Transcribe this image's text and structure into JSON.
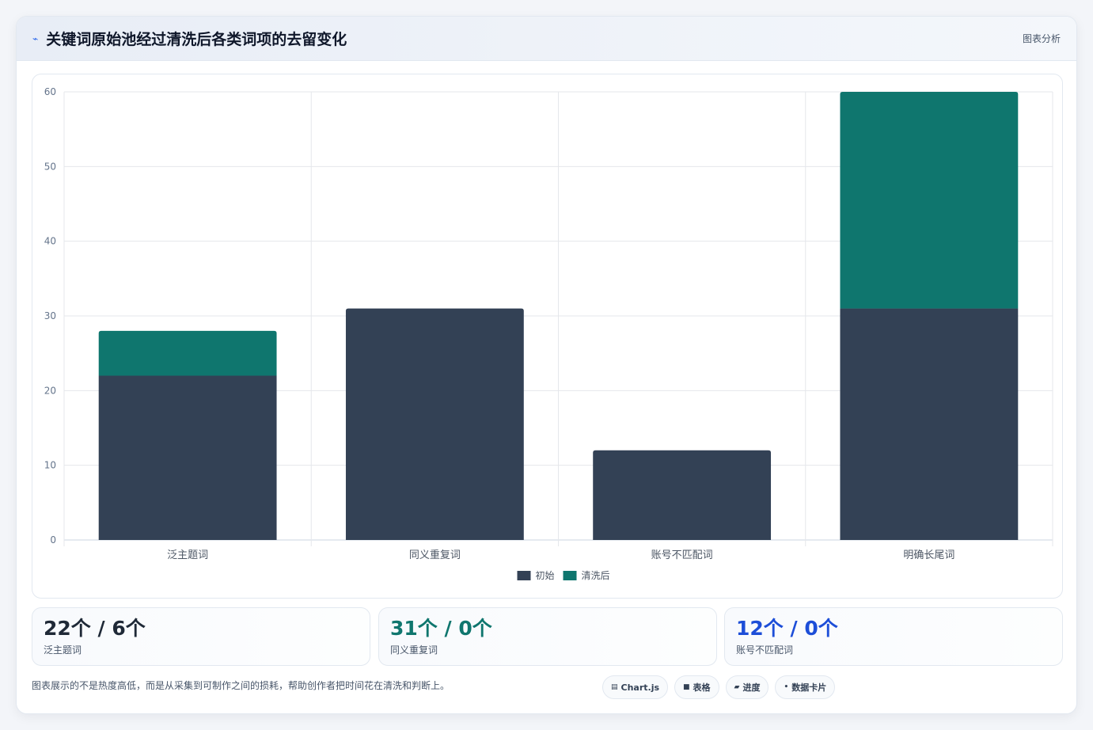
{
  "header": {
    "title_icon": "chart-line-icon",
    "title": "关键词原始池经过清洗后各类词项的去留变化",
    "right_label": "图表分析"
  },
  "chart_data": {
    "type": "bar",
    "stacked": true,
    "categories": [
      "泛主题词",
      "同义重复词",
      "账号不匹配词",
      "明确长尾词"
    ],
    "series": [
      {
        "name": "初始",
        "values": [
          22,
          31,
          12,
          31
        ],
        "color": "#334155"
      },
      {
        "name": "清洗后",
        "values": [
          6,
          0,
          0,
          29
        ],
        "color": "#0f766e"
      }
    ],
    "ylim": [
      0,
      60
    ],
    "yticks": [
      0,
      10,
      20,
      30,
      40,
      50,
      60
    ],
    "grid": true,
    "legend": "bottom"
  },
  "stats": [
    {
      "value": "22个 / 6个",
      "label": "泛主题词",
      "color": "#1f2937"
    },
    {
      "value": "31个 / 0个",
      "label": "同义重复词",
      "color": "#0f766e"
    },
    {
      "value": "12个 / 0个",
      "label": "账号不匹配词",
      "color": "#1d4ed8"
    }
  ],
  "footnote": "图表展示的不是热度高低，而是从采集到可制作之间的损耗，帮助创作者把时间花在清洗和判断上。",
  "tags": [
    {
      "icon": "chart-icon",
      "label": "Chart.js"
    },
    {
      "icon": "table-icon",
      "label": "表格"
    },
    {
      "icon": "progress-icon",
      "label": "进度"
    },
    {
      "icon": "card-icon",
      "label": "数据卡片"
    }
  ]
}
